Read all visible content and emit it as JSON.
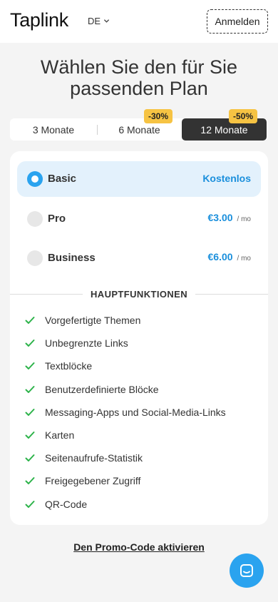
{
  "header": {
    "logo": "Taplink",
    "language": "DE",
    "login_label": "Anmelden"
  },
  "title": {
    "line1": "Wählen Sie den für Sie",
    "line2": "passenden Plan"
  },
  "periods": {
    "items": [
      {
        "label": "3 Monate",
        "badge": ""
      },
      {
        "label": "6 Monate",
        "badge": "-30%"
      },
      {
        "label": "12 Monate",
        "badge": "-50%"
      }
    ],
    "selected": "12 Monate"
  },
  "plans": [
    {
      "name": "Basic",
      "price": "Kostenlos",
      "unit": "",
      "selected": true
    },
    {
      "name": "Pro",
      "price": "€3.00",
      "unit": "/ mo",
      "selected": false
    },
    {
      "name": "Business",
      "price": "€6.00",
      "unit": "/ mo",
      "selected": false
    }
  ],
  "features": {
    "heading": "HAUPTFUNKTIONEN",
    "items": [
      "Vorgefertigte Themen",
      "Unbegrenzte Links",
      "Textblöcke",
      "Benutzerdefinierte Blöcke",
      "Messaging-Apps und Social-Media-Links",
      "Karten",
      "Seitenaufrufe-Statistik",
      "Freigegebener Zugriff",
      "QR-Code"
    ]
  },
  "promo_label": "Den Promo-Code aktivieren",
  "icons": {
    "check": "check-icon",
    "chat": "chat-icon",
    "chevron": "chevron-down-icon"
  },
  "colors": {
    "accent_blue": "#1a8fdc",
    "selected_period_bg": "#333333",
    "badge_bg": "#f6c343",
    "check_green": "#2db34a",
    "active_plan_bg": "#e3f1fc"
  }
}
